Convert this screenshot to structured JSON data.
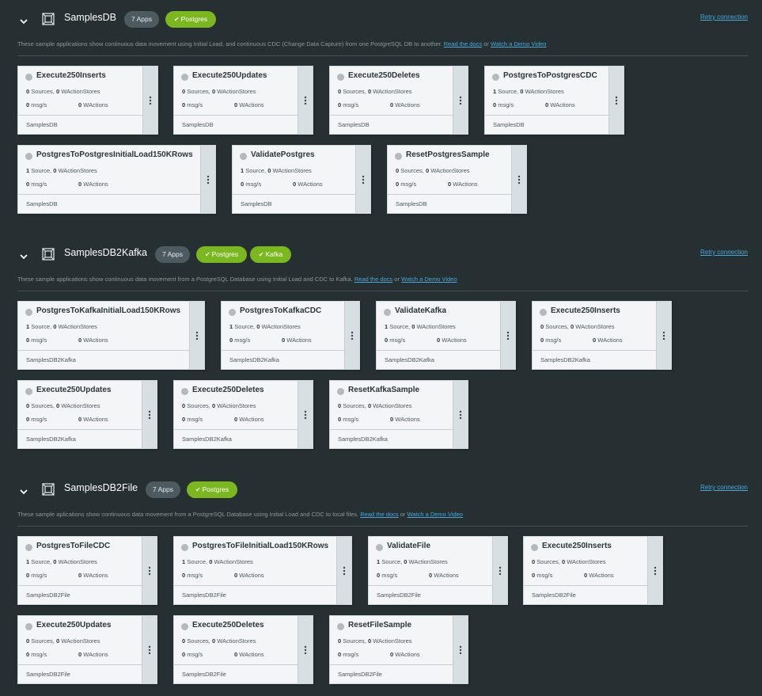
{
  "colors": {
    "background": "#263033",
    "card": "#f3f5f6",
    "tag_green": "#7bb71f",
    "apps_pill": "#4d5a60",
    "link": "#4aa8d8"
  },
  "icons": {
    "collapse": "chevron-down-icon",
    "namespace": "namespace-icon",
    "tag_check": "check-icon",
    "card_status": "status-dot-icon",
    "card_menu": "kebab-menu-icon"
  },
  "groups": [
    {
      "title": "SamplesDB",
      "apps_label": "7 Apps",
      "tags": [
        "Postgres"
      ],
      "retry_label": "Retry connection",
      "description": "These sample applications show continuous data movement using Initial Load, and continuous CDC (Change Data Capture) from one PostgreSQL DB to another.",
      "docs_label": "Read the docs",
      "or_label": "or",
      "video_label": "Watch a Demo Video",
      "cards": [
        {
          "name": "Execute250Inserts",
          "sources": "0",
          "sources_label": "Sources,",
          "stores": "0",
          "stores_label": "WActionStores",
          "rate": "0",
          "rate_label": "msg/s",
          "wactions": "0",
          "wactions_label": "WActions",
          "namespace": "SamplesDB"
        },
        {
          "name": "Execute250Updates",
          "sources": "0",
          "sources_label": "Sources,",
          "stores": "0",
          "stores_label": "WActionStores",
          "rate": "0",
          "rate_label": "msg/s",
          "wactions": "0",
          "wactions_label": "WActions",
          "namespace": "SamplesDB"
        },
        {
          "name": "Execute250Deletes",
          "sources": "0",
          "sources_label": "Sources,",
          "stores": "0",
          "stores_label": "WActionStores",
          "rate": "0",
          "rate_label": "msg/s",
          "wactions": "0",
          "wactions_label": "WActions",
          "namespace": "SamplesDB"
        },
        {
          "name": "PostgresToPostgresCDC",
          "sources": "1",
          "sources_label": "Source,",
          "stores": "0",
          "stores_label": "WActionStores",
          "rate": "0",
          "rate_label": "msg/s",
          "wactions": "0",
          "wactions_label": "WActions",
          "namespace": "SamplesDB"
        },
        {
          "name": "PostgresToPostgresInitialLoad150KRows",
          "sources": "1",
          "sources_label": "Source,",
          "stores": "0",
          "stores_label": "WActionStores",
          "rate": "0",
          "rate_label": "msg/s",
          "wactions": "0",
          "wactions_label": "WActions",
          "namespace": "SamplesDB"
        },
        {
          "name": "ValidatePostgres",
          "sources": "1",
          "sources_label": "Source,",
          "stores": "0",
          "stores_label": "WActionStores",
          "rate": "0",
          "rate_label": "msg/s",
          "wactions": "0",
          "wactions_label": "WActions",
          "namespace": "SamplesDB"
        },
        {
          "name": "ResetPostgresSample",
          "sources": "0",
          "sources_label": "Sources,",
          "stores": "0",
          "stores_label": "WActionStores",
          "rate": "0",
          "rate_label": "msg/s",
          "wactions": "0",
          "wactions_label": "WActions",
          "namespace": "SamplesDB"
        }
      ]
    },
    {
      "title": "SamplesDB2Kafka",
      "apps_label": "7 Apps",
      "tags": [
        "Postgres",
        "Kafka"
      ],
      "retry_label": "Retry connection",
      "description": "These sample applications show continuous data movement from a PostgreSQL Database using Initial Load and CDC to Kafka.",
      "docs_label": "Read the docs",
      "or_label": "or",
      "video_label": "Watch a Demo Video",
      "cards": [
        {
          "name": "PostgresToKafkaInitialLoad150KRows",
          "sources": "1",
          "sources_label": "Source,",
          "stores": "0",
          "stores_label": "WActionStores",
          "rate": "0",
          "rate_label": "msg/s",
          "wactions": "0",
          "wactions_label": "WActions",
          "namespace": "SamplesDB2Kafka"
        },
        {
          "name": "PostgresToKafkaCDC",
          "sources": "1",
          "sources_label": "Source,",
          "stores": "0",
          "stores_label": "WActionStores",
          "rate": "0",
          "rate_label": "msg/s",
          "wactions": "0",
          "wactions_label": "WActions",
          "namespace": "SamplesDB2Kafka"
        },
        {
          "name": "ValidateKafka",
          "sources": "1",
          "sources_label": "Source,",
          "stores": "0",
          "stores_label": "WActionStores",
          "rate": "0",
          "rate_label": "msg/s",
          "wactions": "0",
          "wactions_label": "WActions",
          "namespace": "SamplesDB2Kafka"
        },
        {
          "name": "Execute250Inserts",
          "sources": "0",
          "sources_label": "Sources,",
          "stores": "0",
          "stores_label": "WActionStores",
          "rate": "0",
          "rate_label": "msg/s",
          "wactions": "0",
          "wactions_label": "WActions",
          "namespace": "SamplesDB2Kafka"
        },
        {
          "name": "Execute250Updates",
          "sources": "0",
          "sources_label": "Sources,",
          "stores": "0",
          "stores_label": "WActionStores",
          "rate": "0",
          "rate_label": "msg/s",
          "wactions": "0",
          "wactions_label": "WActions",
          "namespace": "SamplesDB2Kafka"
        },
        {
          "name": "Execute250Deletes",
          "sources": "0",
          "sources_label": "Sources,",
          "stores": "0",
          "stores_label": "WActionStores",
          "rate": "0",
          "rate_label": "msg/s",
          "wactions": "0",
          "wactions_label": "WActions",
          "namespace": "SamplesDB2Kafka"
        },
        {
          "name": "ResetKafkaSample",
          "sources": "0",
          "sources_label": "Sources,",
          "stores": "0",
          "stores_label": "WActionStores",
          "rate": "0",
          "rate_label": "msg/s",
          "wactions": "0",
          "wactions_label": "WActions",
          "namespace": "SamplesDB2Kafka"
        }
      ]
    },
    {
      "title": "SamplesDB2File",
      "apps_label": "7 Apps",
      "tags": [
        "Postgres"
      ],
      "retry_label": "Retry connection",
      "description": "These sample aplications show continuous data movement from a PostgreSQL Database using Initial Load and CDC to local files.",
      "docs_label": "Read the docs",
      "or_label": "or",
      "video_label": "Watch a Demo Video",
      "cards": [
        {
          "name": "PostgresToFileCDC",
          "sources": "1",
          "sources_label": "Source,",
          "stores": "0",
          "stores_label": "WActionStores",
          "rate": "0",
          "rate_label": "msg/s",
          "wactions": "0",
          "wactions_label": "WActions",
          "namespace": "SamplesDB2File"
        },
        {
          "name": "PostgresToFileInitialLoad150KRows",
          "sources": "1",
          "sources_label": "Source,",
          "stores": "0",
          "stores_label": "WActionStores",
          "rate": "0",
          "rate_label": "msg/s",
          "wactions": "0",
          "wactions_label": "WActions",
          "namespace": "SamplesDB2File"
        },
        {
          "name": "ValidateFile",
          "sources": "1",
          "sources_label": "Source,",
          "stores": "0",
          "stores_label": "WActionStores",
          "rate": "0",
          "rate_label": "msg/s",
          "wactions": "0",
          "wactions_label": "WActions",
          "namespace": "SamplesDB2File"
        },
        {
          "name": "Execute250Inserts",
          "sources": "0",
          "sources_label": "Sources,",
          "stores": "0",
          "stores_label": "WActionStores",
          "rate": "0",
          "rate_label": "msg/s",
          "wactions": "0",
          "wactions_label": "WActions",
          "namespace": "SamplesDB2File"
        },
        {
          "name": "Execute250Updates",
          "sources": "0",
          "sources_label": "Sources,",
          "stores": "0",
          "stores_label": "WActionStores",
          "rate": "0",
          "rate_label": "msg/s",
          "wactions": "0",
          "wactions_label": "WActions",
          "namespace": "SamplesDB2File"
        },
        {
          "name": "Execute250Deletes",
          "sources": "0",
          "sources_label": "Sources,",
          "stores": "0",
          "stores_label": "WActionStores",
          "rate": "0",
          "rate_label": "msg/s",
          "wactions": "0",
          "wactions_label": "WActions",
          "namespace": "SamplesDB2File"
        },
        {
          "name": "ResetFileSample",
          "sources": "0",
          "sources_label": "Sources,",
          "stores": "0",
          "stores_label": "WActionStores",
          "rate": "0",
          "rate_label": "msg/s",
          "wactions": "0",
          "wactions_label": "WActions",
          "namespace": "SamplesDB2File"
        }
      ]
    }
  ]
}
